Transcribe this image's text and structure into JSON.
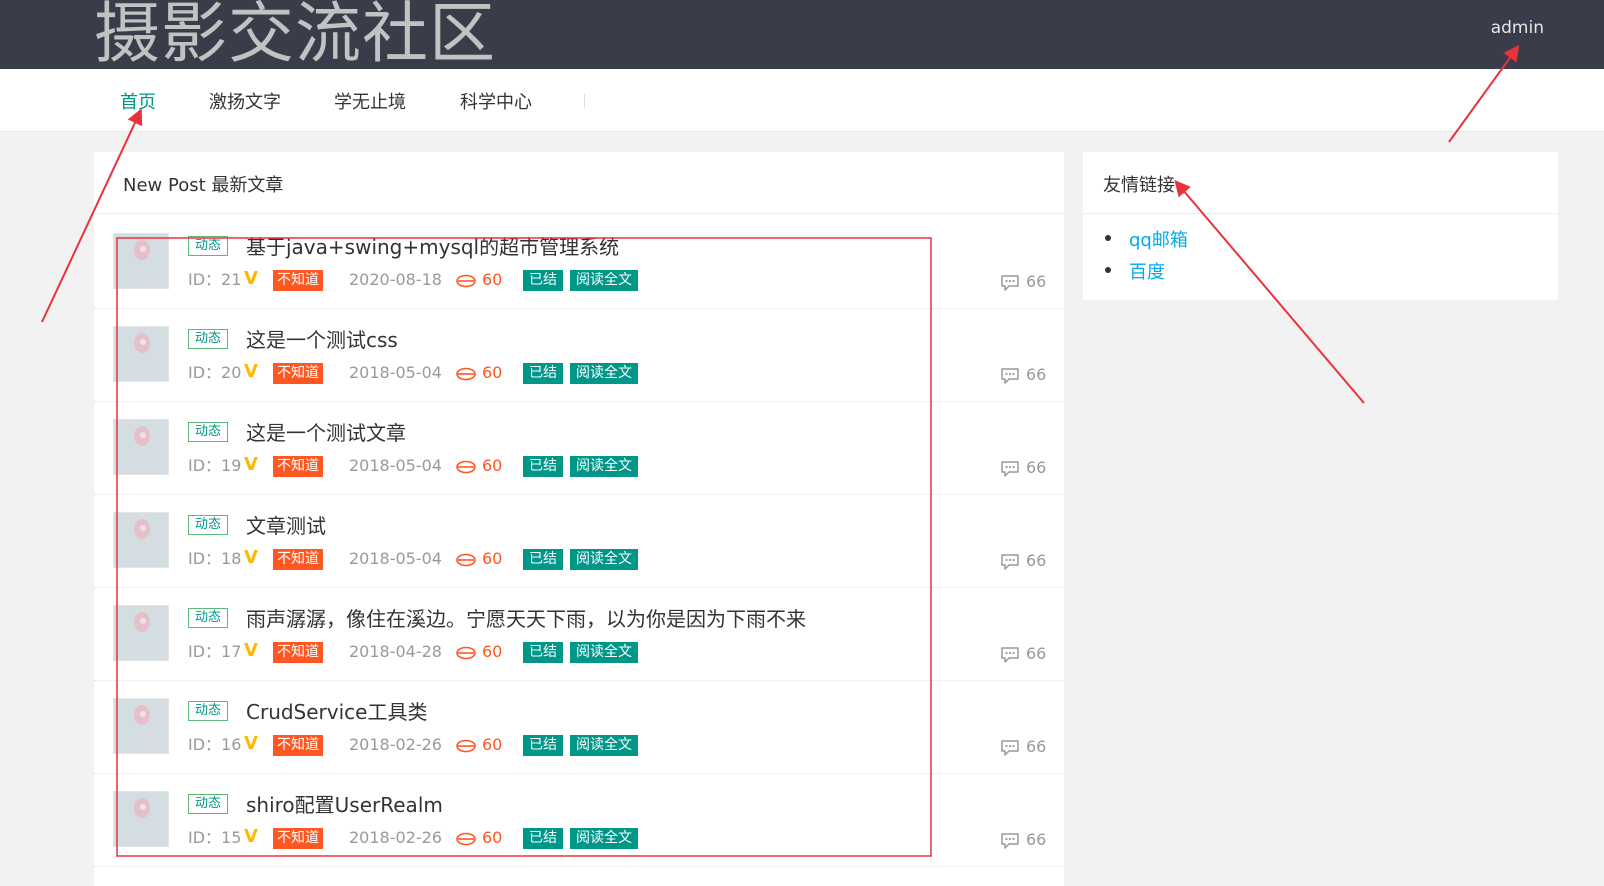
{
  "header": {
    "logo": "摄影交流社区",
    "user": "admin"
  },
  "nav": {
    "items": [
      "首页",
      "激扬文字",
      "学无止境",
      "科学中心"
    ]
  },
  "main": {
    "title": "New Post 最新文章",
    "posts": [
      {
        "tag": "动态",
        "title": "基于java+swing+mysql的超市管理系统",
        "id": "ID：21",
        "level": "V",
        "badge": "不知道",
        "date": "2020-08-18",
        "views": "60",
        "status": "已结",
        "read": "阅读全文",
        "comments": "66"
      },
      {
        "tag": "动态",
        "title": "这是一个测试css",
        "id": "ID：20",
        "level": "V",
        "badge": "不知道",
        "date": "2018-05-04",
        "views": "60",
        "status": "已结",
        "read": "阅读全文",
        "comments": "66"
      },
      {
        "tag": "动态",
        "title": "这是一个测试文章",
        "id": "ID：19",
        "level": "V",
        "badge": "不知道",
        "date": "2018-05-04",
        "views": "60",
        "status": "已结",
        "read": "阅读全文",
        "comments": "66"
      },
      {
        "tag": "动态",
        "title": "文章测试",
        "id": "ID：18",
        "level": "V",
        "badge": "不知道",
        "date": "2018-05-04",
        "views": "60",
        "status": "已结",
        "read": "阅读全文",
        "comments": "66"
      },
      {
        "tag": "动态",
        "title": "雨声潺潺，像住在溪边。宁愿天天下雨，以为你是因为下雨不来",
        "id": "ID：17",
        "level": "V",
        "badge": "不知道",
        "date": "2018-04-28",
        "views": "60",
        "status": "已结",
        "read": "阅读全文",
        "comments": "66"
      },
      {
        "tag": "动态",
        "title": "CrudService工具类",
        "id": "ID：16",
        "level": "V",
        "badge": "不知道",
        "date": "2018-02-26",
        "views": "60",
        "status": "已结",
        "read": "阅读全文",
        "comments": "66"
      },
      {
        "tag": "动态",
        "title": "shiro配置UserRealm",
        "id": "ID：15",
        "level": "V",
        "badge": "不知道",
        "date": "2018-02-26",
        "views": "60",
        "status": "已结",
        "read": "阅读全文",
        "comments": "66"
      }
    ]
  },
  "sidebar": {
    "title": "友情链接",
    "links": [
      "qq邮箱",
      "百度"
    ]
  },
  "colors": {
    "topbar": "#393d49",
    "accent": "#009688",
    "badge": "#ff5722",
    "level": "#ffb800",
    "link": "#01aaed",
    "annotation": "#e8323c"
  }
}
